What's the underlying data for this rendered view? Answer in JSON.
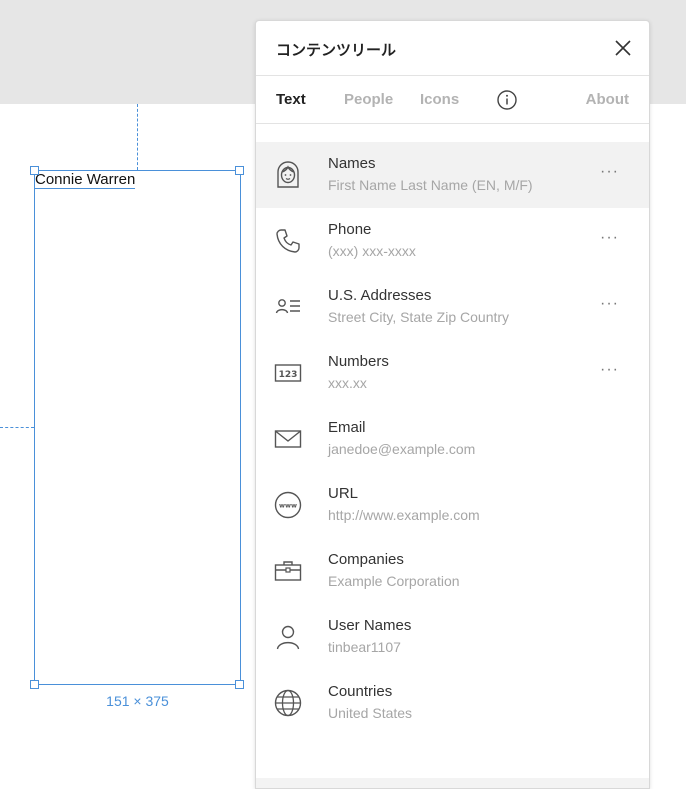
{
  "canvas": {
    "frame_text": "Connie Warren",
    "dimensions": "151 × 375"
  },
  "panel": {
    "title": "コンテンツリール",
    "tabs": [
      {
        "label": "Text",
        "active": true
      },
      {
        "label": "People",
        "active": false
      },
      {
        "label": "Icons",
        "active": false
      },
      {
        "label": "About",
        "active": false
      }
    ],
    "items": [
      {
        "name": "Names",
        "sub": "First Name Last Name (EN, M/F)",
        "icon": "face-icon",
        "more": "···"
      },
      {
        "name": "Phone",
        "sub": "(xxx) xxx-xxxx",
        "icon": "phone-icon",
        "more": "···"
      },
      {
        "name": "U.S. Addresses",
        "sub": "Street City, State Zip Country",
        "icon": "address-icon",
        "more": "···"
      },
      {
        "name": "Numbers",
        "sub": "xxx.xx",
        "icon": "numbers-icon",
        "icon_text": "123",
        "more": "···"
      },
      {
        "name": "Email",
        "sub": "janedoe@example.com",
        "icon": "email-icon"
      },
      {
        "name": "URL",
        "sub": "http://www.example.com",
        "icon": "url-icon",
        "icon_text": "www"
      },
      {
        "name": "Companies",
        "sub": "Example Corporation",
        "icon": "briefcase-icon"
      },
      {
        "name": "User Names",
        "sub": "tinbear1107",
        "icon": "user-icon"
      },
      {
        "name": "Countries",
        "sub": "United States",
        "icon": "globe-icon"
      }
    ]
  },
  "colors": {
    "selection_blue": "#4a90d9",
    "selected_row": "#f2f2f2"
  }
}
